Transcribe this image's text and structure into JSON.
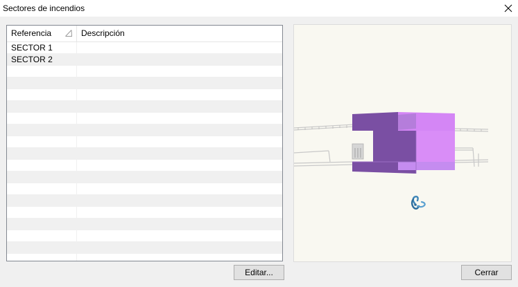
{
  "window": {
    "title": "Sectores de incendios",
    "close_icon": "close-icon"
  },
  "table": {
    "columns": [
      "Referencia",
      "Descripción"
    ],
    "sort_column": "Referencia",
    "sort_direction": "ascending",
    "rows": [
      {
        "referencia": "SECTOR 1",
        "descripcion": ""
      },
      {
        "referencia": "SECTOR 2",
        "descripcion": ""
      }
    ]
  },
  "viewer": {
    "sector_color": "#c58cf0",
    "dark_sector_color": "#7a4fa3",
    "background": "#f9f8f1",
    "orbit_icon": "rotate-orbit-icon"
  },
  "buttons": {
    "edit_label": "Editar...",
    "close_label": "Cerrar"
  }
}
